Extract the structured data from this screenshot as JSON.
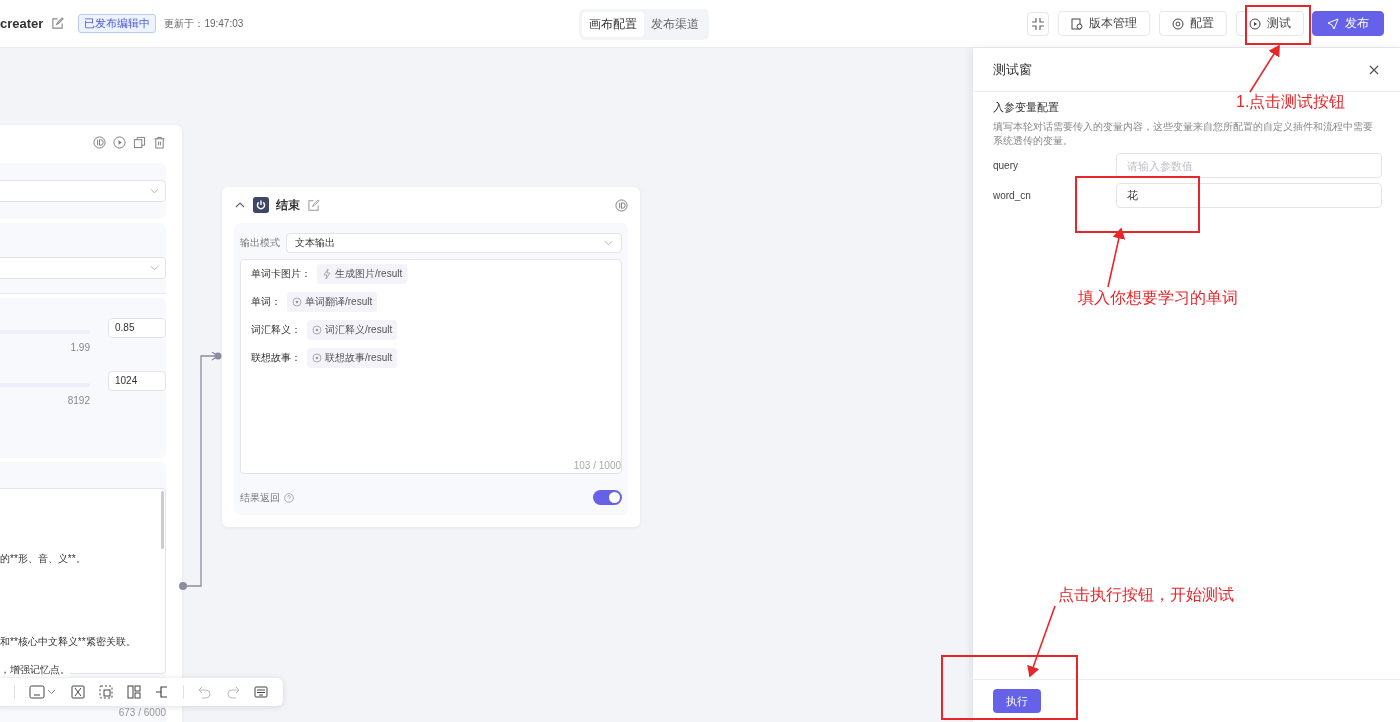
{
  "header": {
    "title": "creater",
    "status_badge": "已发布编辑中",
    "updated": "更新于：19:47:03",
    "view_tabs": [
      {
        "label": "画布配置",
        "selected": true
      },
      {
        "label": "发布渠道",
        "selected": false
      }
    ],
    "buttons": [
      {
        "label": "版本管理",
        "kind": "history",
        "primary": false
      },
      {
        "label": "配置",
        "kind": "settings",
        "primary": false
      },
      {
        "label": "测试",
        "kind": "play",
        "primary": false
      },
      {
        "label": "发布",
        "kind": "send",
        "primary": true
      }
    ]
  },
  "left_node": {
    "parameters": [
      {
        "max": "1.99",
        "value": "0.85"
      },
      {
        "max": "8192",
        "value": "1024"
      }
    ],
    "prompt_lines": [
      "的**形、音、义**。",
      "和**核心中文释义**紧密关联。",
      "，增强记忆点。"
    ],
    "counter": "673 / 6000"
  },
  "end_node": {
    "title": "结束",
    "output_mode_label": "输出模式",
    "output_mode": "文本输出",
    "outputs": [
      {
        "label": "单词卡图片：",
        "source": "生成图片/result",
        "kind": "plugin"
      },
      {
        "label": "单词：",
        "source": "单词翻译/result",
        "kind": "node"
      },
      {
        "label": "词汇释义：",
        "source": "词汇释义/result",
        "kind": "node"
      },
      {
        "label": "联想故事：",
        "source": "联想故事/result",
        "kind": "node"
      }
    ],
    "counter": "103 / 1000",
    "return_label": "结果返回",
    "return_on": true
  },
  "test_panel": {
    "title": "测试窗",
    "section_title": "入参变量配置",
    "description": "填写本轮对话需要传入的变量内容，这些变量来自您所配置的自定义插件和流程中需要系统透传的变量。",
    "params": [
      {
        "name": "query",
        "placeholder": "请输入参数值"
      },
      {
        "name": "word_cn",
        "value": "花"
      }
    ],
    "run_button": "执行"
  },
  "annotations": [
    {
      "text": "1.点击测试按钮"
    },
    {
      "text": "填入你想要学习的单词"
    },
    {
      "text": "点击执行按钮，开始测试"
    }
  ]
}
